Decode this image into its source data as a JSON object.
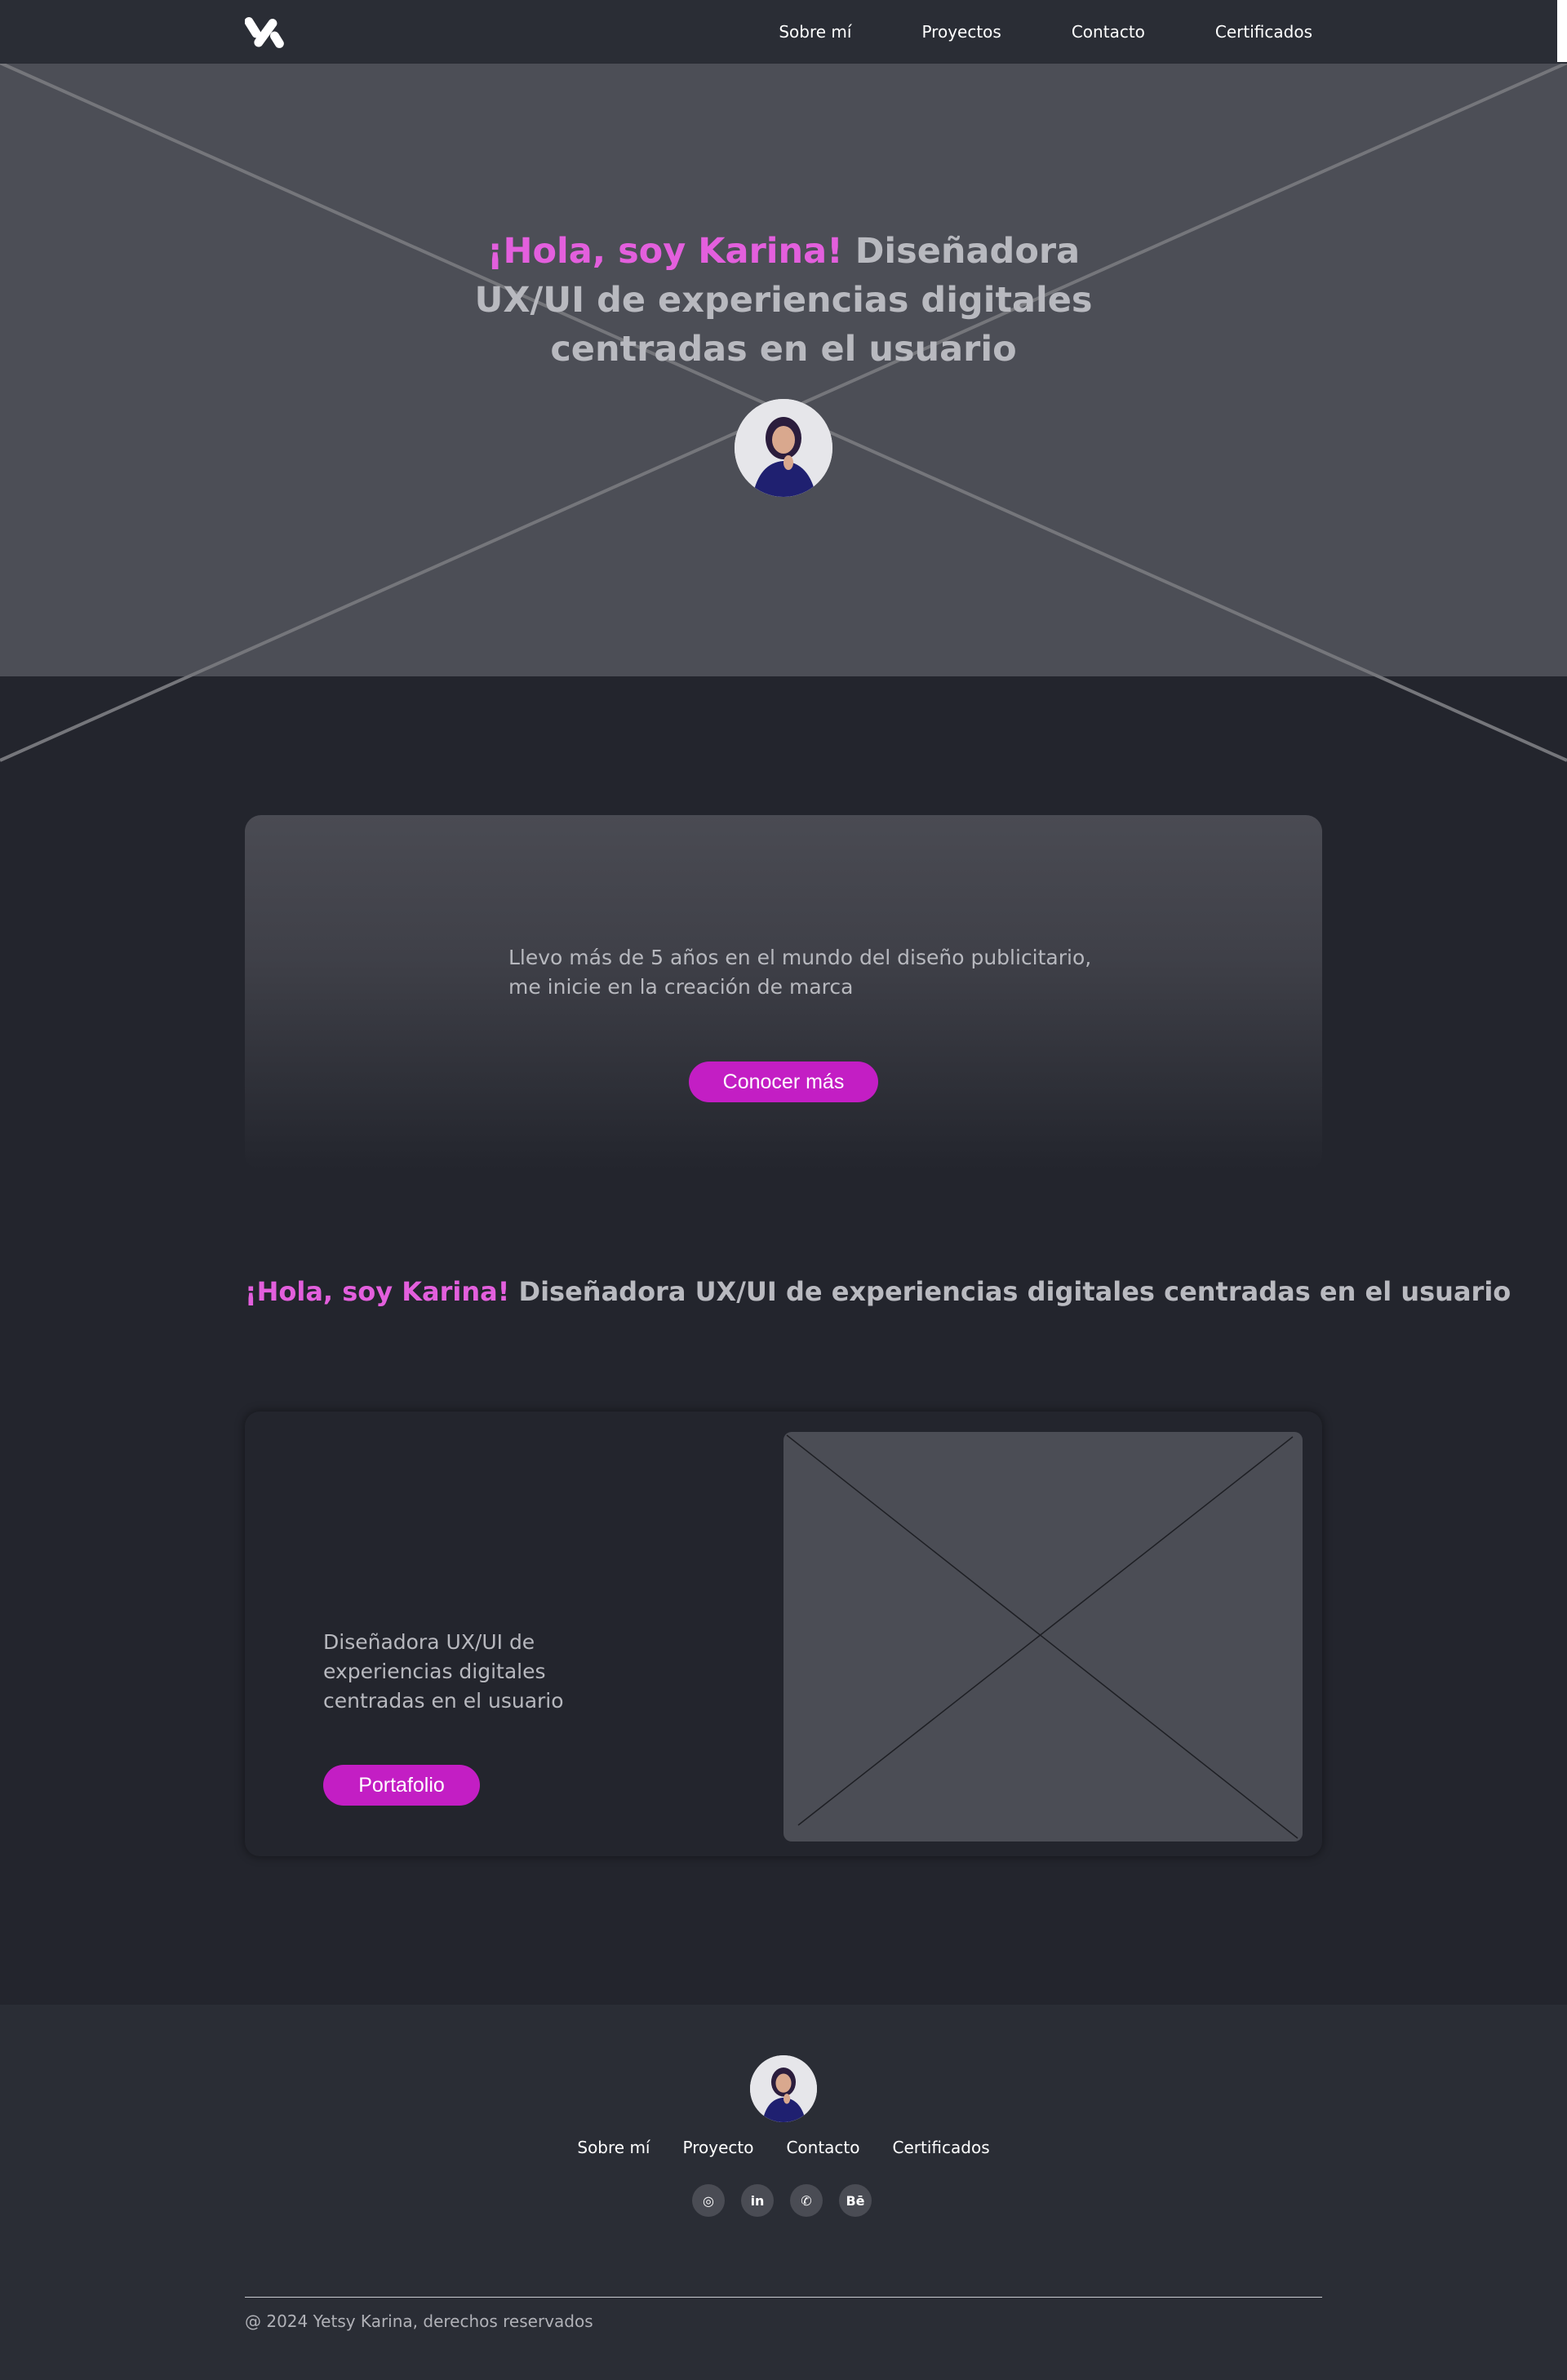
{
  "nav": {
    "links": [
      "Sobre mí",
      "Proyectos",
      "Contacto",
      "Certificados"
    ]
  },
  "hero": {
    "greeting": "¡Hola, soy Karina!",
    "tagline": " Diseñadora UX/UI de experiencias digitales centradas en el usuario"
  },
  "about": {
    "text": "Llevo más de 5 años en el mundo del diseño publicitario, me inicie en la creación de marca",
    "button": "Conocer más"
  },
  "headline2": {
    "greeting": "¡Hola, soy Karina!",
    "tagline": " Diseñadora UX/UI de experiencias digitales centradas en el usuario"
  },
  "project": {
    "text": "Diseñadora UX/UI de experiencias digitales centradas en el usuario",
    "button": "Portafolio"
  },
  "footer": {
    "links": [
      "Sobre mí",
      "Proyecto",
      "Contacto",
      "Certificados"
    ],
    "socials": [
      {
        "icon": "instagram-icon",
        "glyph": "◎"
      },
      {
        "icon": "linkedin-icon",
        "glyph": "in"
      },
      {
        "icon": "whatsapp-icon",
        "glyph": "✆"
      },
      {
        "icon": "behance-icon",
        "glyph": "Bē"
      }
    ],
    "copyright": "@ 2024 Yetsy Karina, derechos reservados"
  },
  "colors": {
    "accent": "#e35fdd",
    "button": "#c31ec4",
    "background": "#23252d",
    "nav": "#2a2d35"
  }
}
